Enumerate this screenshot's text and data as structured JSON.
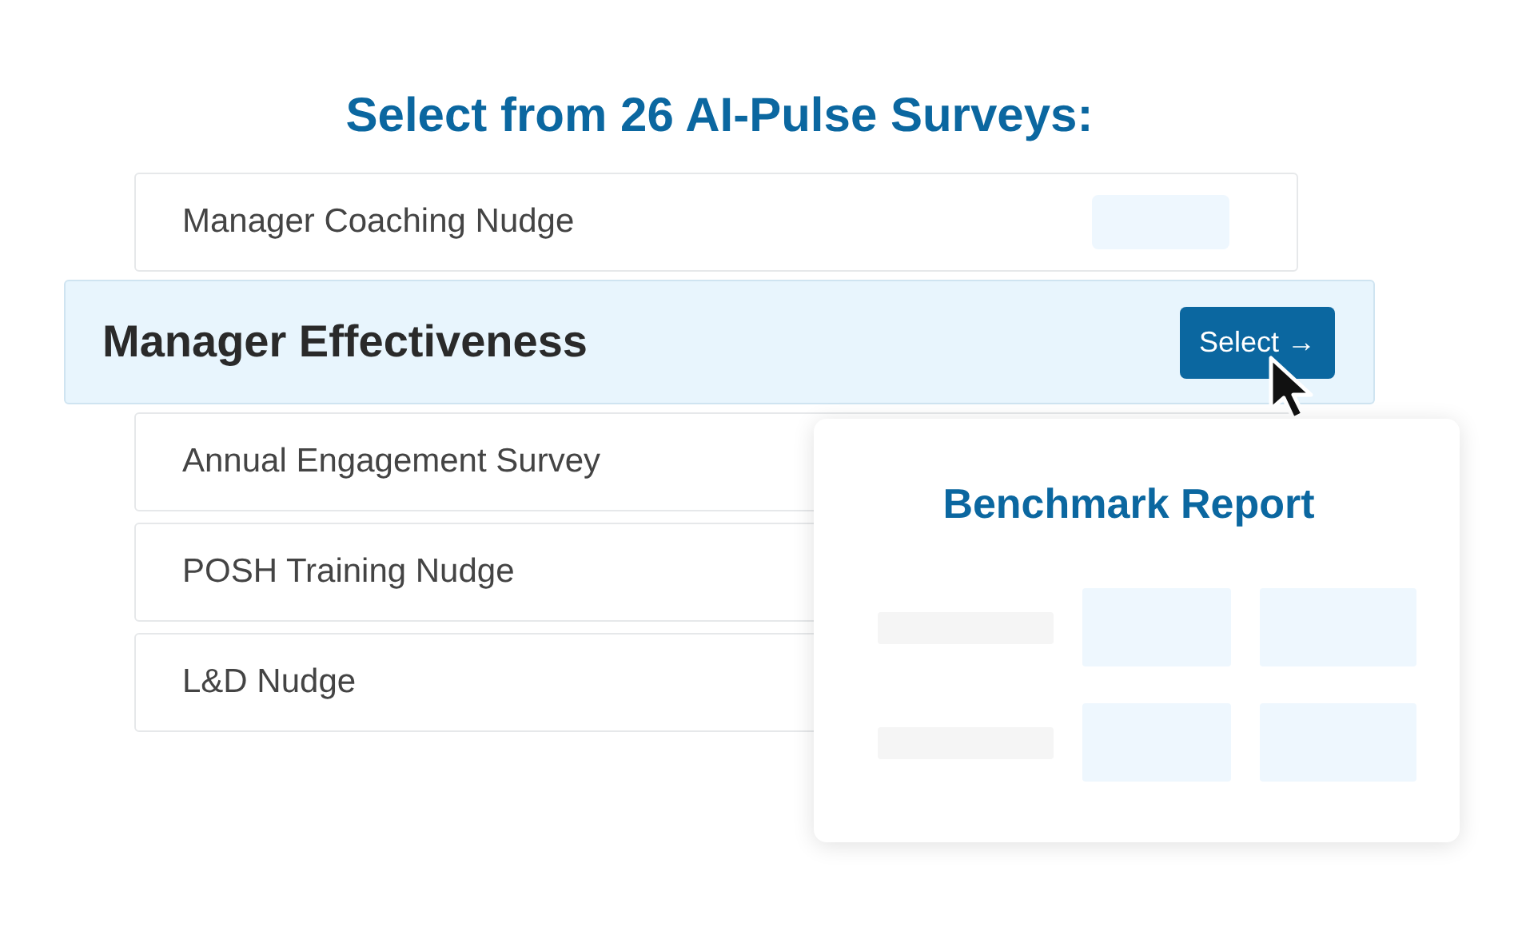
{
  "heading": "Select from 26 AI-Pulse Surveys:",
  "surveys": [
    {
      "name": "Manager Coaching Nudge",
      "selected": false,
      "kind": "tagged"
    },
    {
      "name": "Manager Effectiveness",
      "selected": true
    },
    {
      "name": "Annual Engagement Survey",
      "selected": false,
      "kind": "plain"
    },
    {
      "name": "POSH Training Nudge",
      "selected": false,
      "kind": "plain"
    },
    {
      "name": "L&D Nudge",
      "selected": false,
      "kind": "plain"
    }
  ],
  "select_button": "Select →",
  "report_card": {
    "title": "Benchmark Report"
  }
}
